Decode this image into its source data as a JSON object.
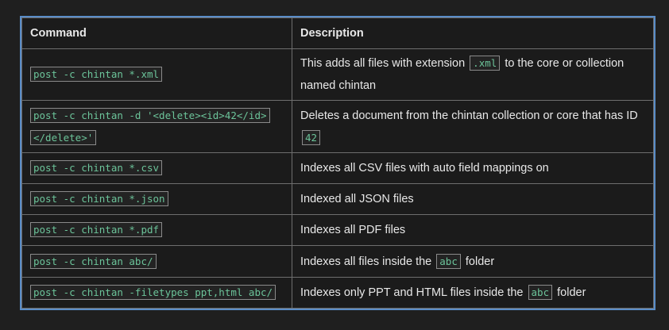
{
  "table": {
    "headers": {
      "command": "Command",
      "description": "Description"
    },
    "rows": [
      {
        "command": "post -c chintan *.xml",
        "desc_before": "This adds all files with extension",
        "desc_code": ".xml",
        "desc_after": "to the core or collection named chintan"
      },
      {
        "command": "post -c chintan -d '<delete><id>42</id></delete>'",
        "desc_before": "Deletes a document from the chintan collection or core that has ID",
        "desc_code": "42",
        "desc_after": ""
      },
      {
        "command": "post -c chintan *.csv",
        "desc_before": "Indexes all CSV files with auto field mappings on",
        "desc_code": "",
        "desc_after": ""
      },
      {
        "command": "post -c chintan *.json",
        "desc_before": "Indexed all JSON files",
        "desc_code": "",
        "desc_after": ""
      },
      {
        "command": "post -c chintan *.pdf",
        "desc_before": "Indexes all PDF files",
        "desc_code": "",
        "desc_after": ""
      },
      {
        "command": "post -c chintan abc/",
        "desc_before": "Indexes all files inside the",
        "desc_code": "abc",
        "desc_after": "folder"
      },
      {
        "command": "post -c chintan -filetypes ppt,html abc/",
        "desc_before": "Indexes only PPT and HTML files inside the",
        "desc_code": "abc",
        "desc_after": "folder"
      }
    ]
  }
}
